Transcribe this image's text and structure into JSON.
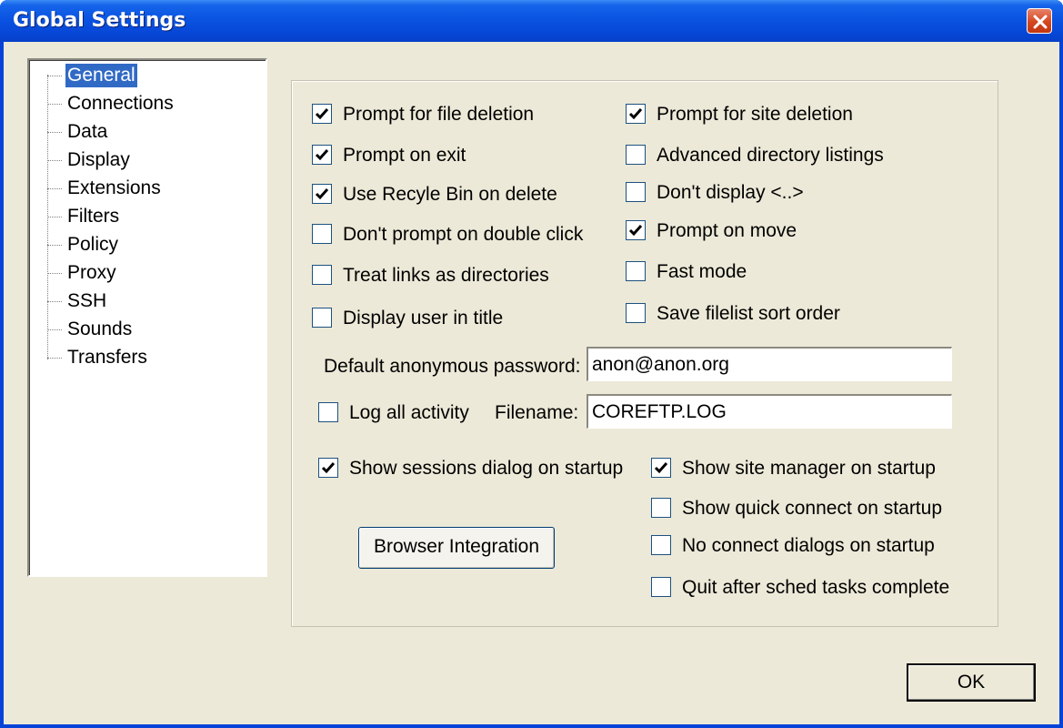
{
  "window": {
    "title": "Global Settings"
  },
  "tree": {
    "items": [
      {
        "label": "General",
        "selected": true
      },
      {
        "label": "Connections",
        "selected": false
      },
      {
        "label": "Data",
        "selected": false
      },
      {
        "label": "Display",
        "selected": false
      },
      {
        "label": "Extensions",
        "selected": false
      },
      {
        "label": "Filters",
        "selected": false
      },
      {
        "label": "Policy",
        "selected": false
      },
      {
        "label": "Proxy",
        "selected": false
      },
      {
        "label": "SSH",
        "selected": false
      },
      {
        "label": "Sounds",
        "selected": false
      },
      {
        "label": "Transfers",
        "selected": false
      }
    ]
  },
  "general": {
    "left_options": [
      {
        "label": "Prompt for file deletion",
        "checked": true
      },
      {
        "label": "Prompt on exit",
        "checked": true
      },
      {
        "label": "Use Recyle Bin on delete",
        "checked": true
      },
      {
        "label": "Don't prompt on double click",
        "checked": false
      },
      {
        "label": "Treat links as directories",
        "checked": false
      },
      {
        "label": "Display user in title",
        "checked": false
      }
    ],
    "right_options": [
      {
        "label": "Prompt for site deletion",
        "checked": true
      },
      {
        "label": "Advanced directory listings",
        "checked": false
      },
      {
        "label": "Don't display <..>",
        "checked": false
      },
      {
        "label": "Prompt on move",
        "checked": true
      },
      {
        "label": "Fast mode",
        "checked": false
      },
      {
        "label": "Save filelist sort order",
        "checked": false
      }
    ],
    "anon_password": {
      "label": "Default anonymous password:",
      "value": "anon@anon.org"
    },
    "log_all": {
      "label": "Log all activity",
      "checked": false
    },
    "filename": {
      "label": "Filename:",
      "value": "COREFTP.LOG"
    },
    "show_sessions": {
      "label": "Show sessions dialog on startup",
      "checked": true
    },
    "startup_options": [
      {
        "label": "Show site manager on startup",
        "checked": true
      },
      {
        "label": "Show quick connect on startup",
        "checked": false
      },
      {
        "label": "No connect dialogs on startup",
        "checked": false
      },
      {
        "label": "Quit after sched tasks complete",
        "checked": false
      }
    ],
    "browser_integration_label": "Browser Integration"
  },
  "footer": {
    "ok_label": "OK"
  }
}
